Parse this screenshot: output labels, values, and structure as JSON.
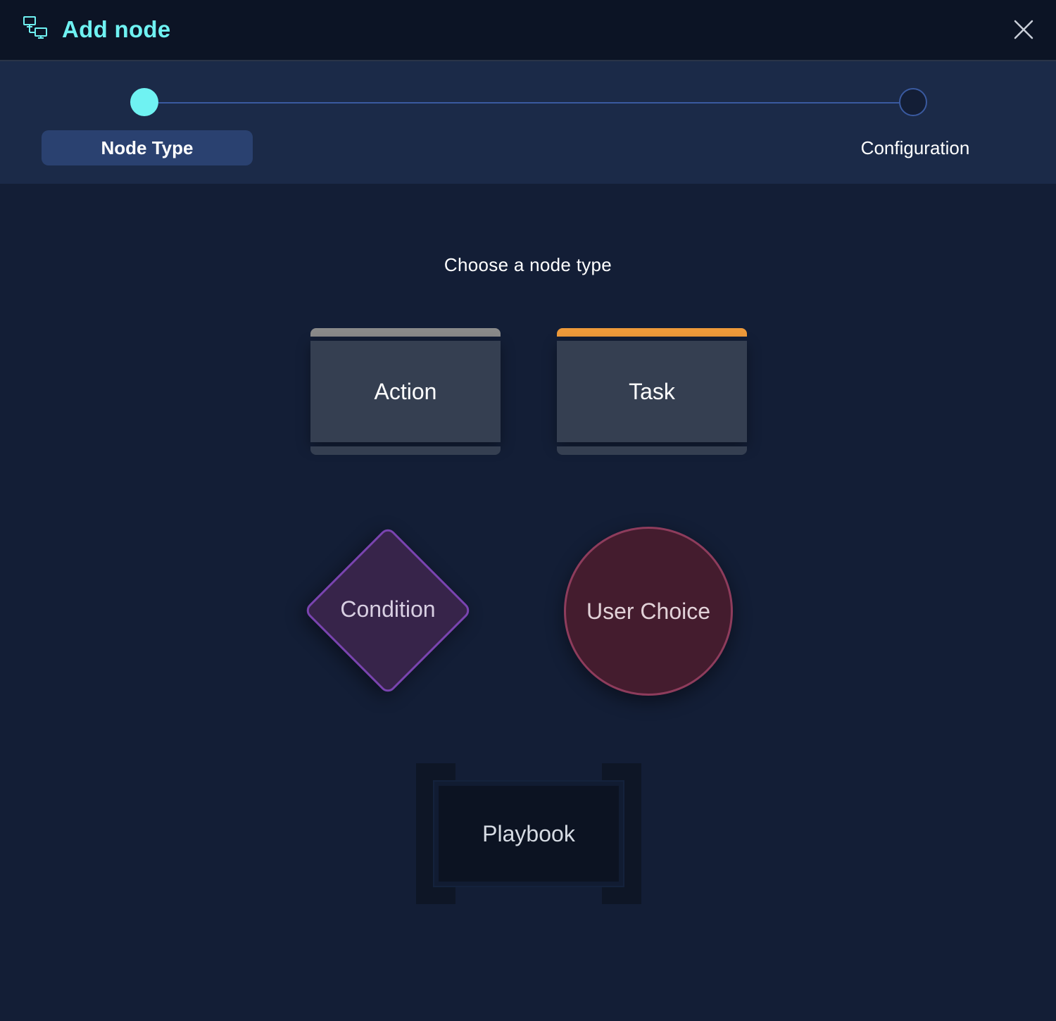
{
  "header": {
    "title": "Add node",
    "icon": "network-nodes-icon",
    "close_icon": "close-icon"
  },
  "stepper": {
    "steps": [
      {
        "label": "Node Type",
        "state": "active"
      },
      {
        "label": "Configuration",
        "state": "inactive"
      }
    ]
  },
  "main": {
    "prompt": "Choose a node type",
    "node_types": [
      {
        "label": "Action",
        "shape": "rectangle",
        "accent": "#8a8a8a"
      },
      {
        "label": "Task",
        "shape": "rectangle",
        "accent": "#ee9a3a"
      },
      {
        "label": "Condition",
        "shape": "diamond",
        "accent": "#7a44b0"
      },
      {
        "label": "User Choice",
        "shape": "circle",
        "accent": "#8e3c5c"
      },
      {
        "label": "Playbook",
        "shape": "bracket",
        "accent": "#0e1626"
      }
    ]
  },
  "colors": {
    "accent_cyan": "#6ff2f2",
    "header_bg": "#0c1425",
    "stepper_bg": "#1b2a48",
    "page_bg": "#131e36",
    "card_bg": "#353f51"
  }
}
